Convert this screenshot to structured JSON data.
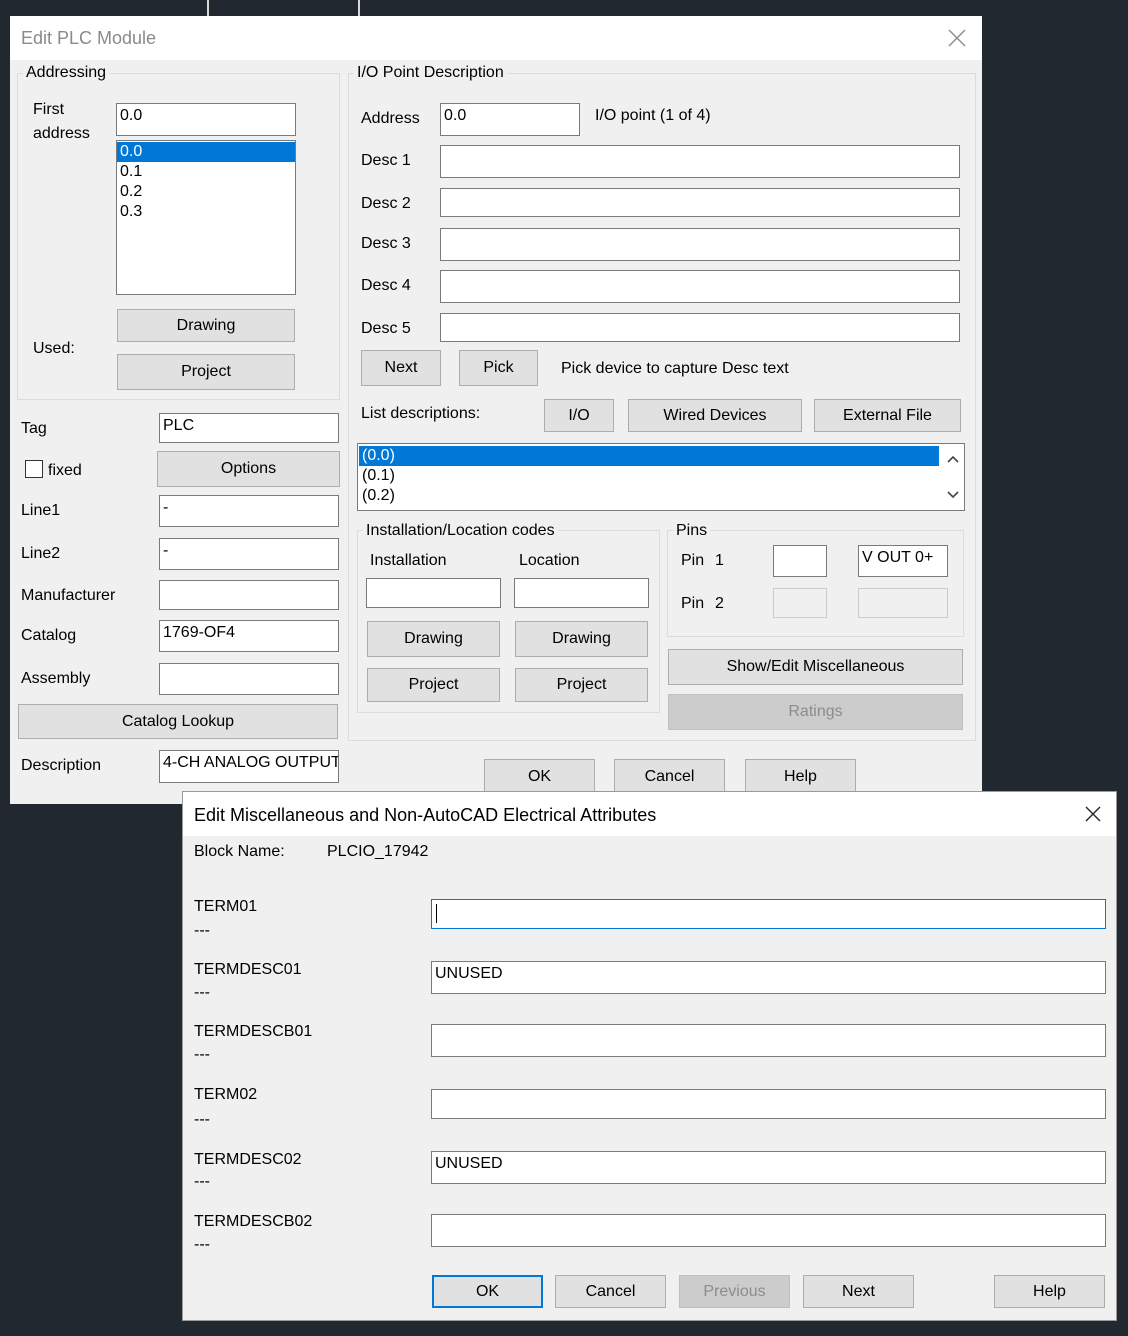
{
  "plc": {
    "title": "Edit PLC Module",
    "addressing": {
      "group_label": "Addressing",
      "first_address_line1": "First",
      "first_address_line2": "address",
      "first_address_value": "0.0",
      "address_list": [
        "0.0",
        "0.1",
        "0.2",
        "0.3"
      ],
      "selected_index": 0,
      "used_label": "Used:",
      "drawing_button": "Drawing",
      "project_button": "Project"
    },
    "tag": {
      "label": "Tag",
      "value": "PLC"
    },
    "fixed_label": "fixed",
    "options_button": "Options",
    "line1": {
      "label": "Line1",
      "value": "-"
    },
    "line2": {
      "label": "Line2",
      "value": "-"
    },
    "manufacturer": {
      "label": "Manufacturer",
      "value": ""
    },
    "catalog": {
      "label": "Catalog",
      "value": "1769-OF4"
    },
    "assembly": {
      "label": "Assembly",
      "value": ""
    },
    "catalog_lookup_button": "Catalog Lookup",
    "description": {
      "label": "Description",
      "value": "4-CH ANALOG OUTPUT"
    },
    "io": {
      "group_label": "I/O Point Description",
      "address_label": "Address",
      "address_value": "0.0",
      "io_point_text": "I/O point (1 of 4)",
      "desc1_label": "Desc 1",
      "desc2_label": "Desc 2",
      "desc3_label": "Desc 3",
      "desc4_label": "Desc 4",
      "desc5_label": "Desc 5",
      "next_button": "Next",
      "pick_button": "Pick",
      "pick_hint": "Pick device to capture Desc text",
      "list_descriptions_label": "List descriptions:",
      "io_button": "I/O",
      "wired_devices_button": "Wired Devices",
      "external_file_button": "External File",
      "desc_list": [
        "(0.0)",
        "(0.1)",
        "(0.2)"
      ],
      "selected_index": 0
    },
    "location": {
      "group_label": "Installation/Location codes",
      "installation_label": "Installation",
      "location_label": "Location",
      "installation_value": "",
      "location_value": "",
      "drawing_button": "Drawing",
      "project_button": "Project"
    },
    "pins": {
      "group_label": "Pins",
      "pin_label": "Pin",
      "pin1_number": "1",
      "pin2_number": "2",
      "pin1_value": "",
      "pin1_desc": "V OUT 0+"
    },
    "show_edit_misc_button": "Show/Edit Miscellaneous",
    "ratings_button": "Ratings",
    "ok_button": "OK",
    "cancel_button": "Cancel",
    "help_button": "Help"
  },
  "misc": {
    "title": "Edit Miscellaneous and Non-AutoCAD Electrical Attributes",
    "block_name_label": "Block Name:",
    "block_name_value": "PLCIO_17942",
    "attributes": [
      {
        "name": "TERM01",
        "sub": "---",
        "value": ""
      },
      {
        "name": "TERMDESC01",
        "sub": "---",
        "value": "UNUSED"
      },
      {
        "name": "TERMDESCB01",
        "sub": "---",
        "value": ""
      },
      {
        "name": "TERM02",
        "sub": "---",
        "value": ""
      },
      {
        "name": "TERMDESC02",
        "sub": "---",
        "value": "UNUSED"
      },
      {
        "name": "TERMDESCB02",
        "sub": "---",
        "value": ""
      }
    ],
    "ok_button": "OK",
    "cancel_button": "Cancel",
    "previous_button": "Previous",
    "next_button": "Next",
    "help_button": "Help"
  },
  "colors": {
    "background": "#212830",
    "dialog": "#f0f0f0",
    "selection": "#0078d7",
    "focus_border": "#0078d7"
  }
}
